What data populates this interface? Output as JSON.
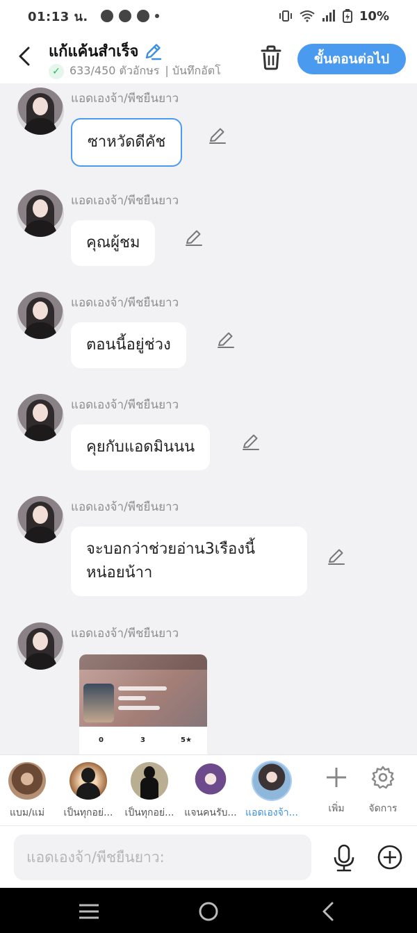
{
  "status_bar": {
    "time": "01:13 น.",
    "battery": "10%"
  },
  "header": {
    "title": "แก้แค้นสำเร็จ",
    "char_count": "633/450 ตัวอักษร",
    "save_status": "| บันทึกอัตโ",
    "next_button": "ขั้นตอนต่อไป"
  },
  "messages": [
    {
      "sender": "แอดเองจ้า/พีชยืนยาว",
      "text": "ซาหวัดดีคัช",
      "selected": true
    },
    {
      "sender": "แอดเองจ้า/พีชยืนยาว",
      "text": "คุณผู้ชม",
      "selected": false
    },
    {
      "sender": "แอดเองจ้า/พีชยืนยาว",
      "text": "ตอนนี้อยู่ช่วง",
      "selected": false
    },
    {
      "sender": "แอดเองจ้า/พีชยืนยาว",
      "text": "คุยกับแอดมินนน",
      "selected": false
    },
    {
      "sender": "แอดเองจ้า/พีชยืนยาว",
      "text": "จะบอกว่าช่วยอ่าน3เรืองนี้หน่อยน้าา",
      "selected": false
    },
    {
      "sender": "แอดเองจ้า/พีชยืนยาว",
      "text": "",
      "selected": false
    }
  ],
  "screenshot_preview": {
    "stat_1": "0",
    "stat_2": "3",
    "stat_3": "5★"
  },
  "characters": [
    {
      "name": "แบม/แม่",
      "active": false
    },
    {
      "name": "เป็นทุกอย่...",
      "active": false
    },
    {
      "name": "เป็นทุกอย่...",
      "active": false
    },
    {
      "name": "แจนคนรับ...",
      "active": false
    },
    {
      "name": "แอดเองจ้า...",
      "active": true
    }
  ],
  "tools": {
    "add_label": "เพิ่ม",
    "manage_label": "จัดการ"
  },
  "input": {
    "placeholder": "แอดเองจ้า/พีชยืนยาว:"
  },
  "colors": {
    "accent": "#4a9af0",
    "background": "#f2f2f4",
    "bubble": "#ffffff",
    "success": "#25b45a"
  }
}
